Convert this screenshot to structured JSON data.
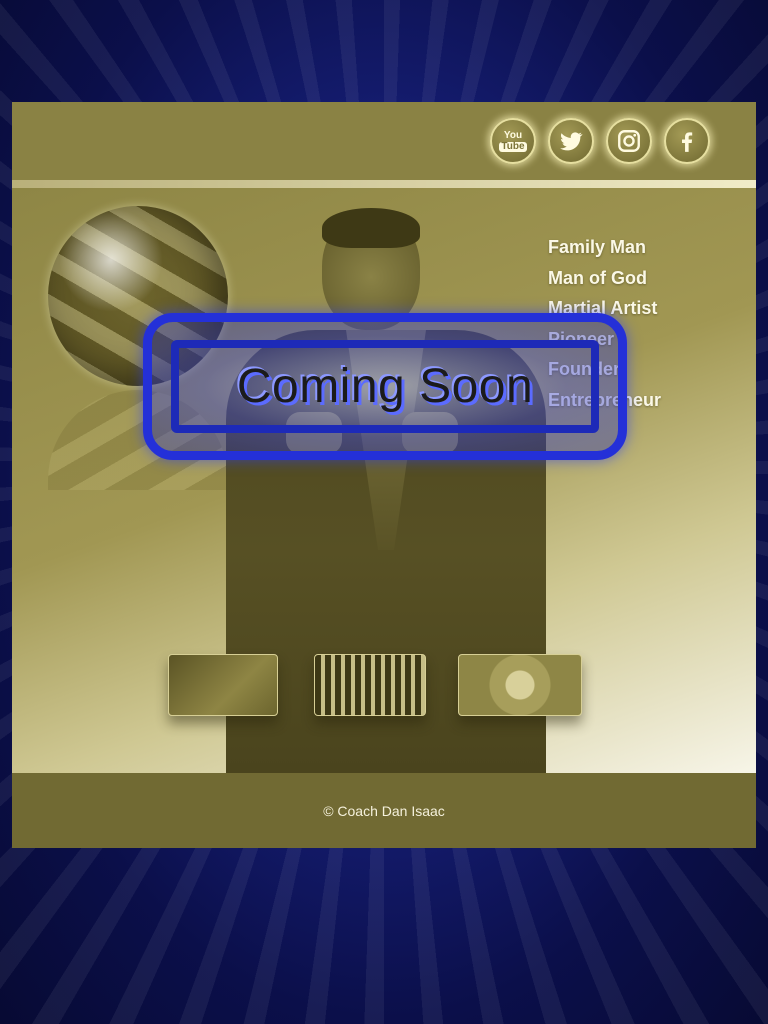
{
  "social": {
    "youtube_top": "You",
    "youtube_bottom": "Tube"
  },
  "tagline": [
    "Family Man",
    "Man of God",
    "Martial Artist",
    "Pioneer",
    "Founder",
    "Entrepreneur"
  ],
  "overlay": {
    "text": "Coming Soon"
  },
  "footer": {
    "copyright": "© Coach Dan Isaac"
  },
  "colors": {
    "background": "#0b0f4a",
    "frame": "#8f8748",
    "accent": "#2430d8",
    "text_light": "#fbf8e6"
  }
}
